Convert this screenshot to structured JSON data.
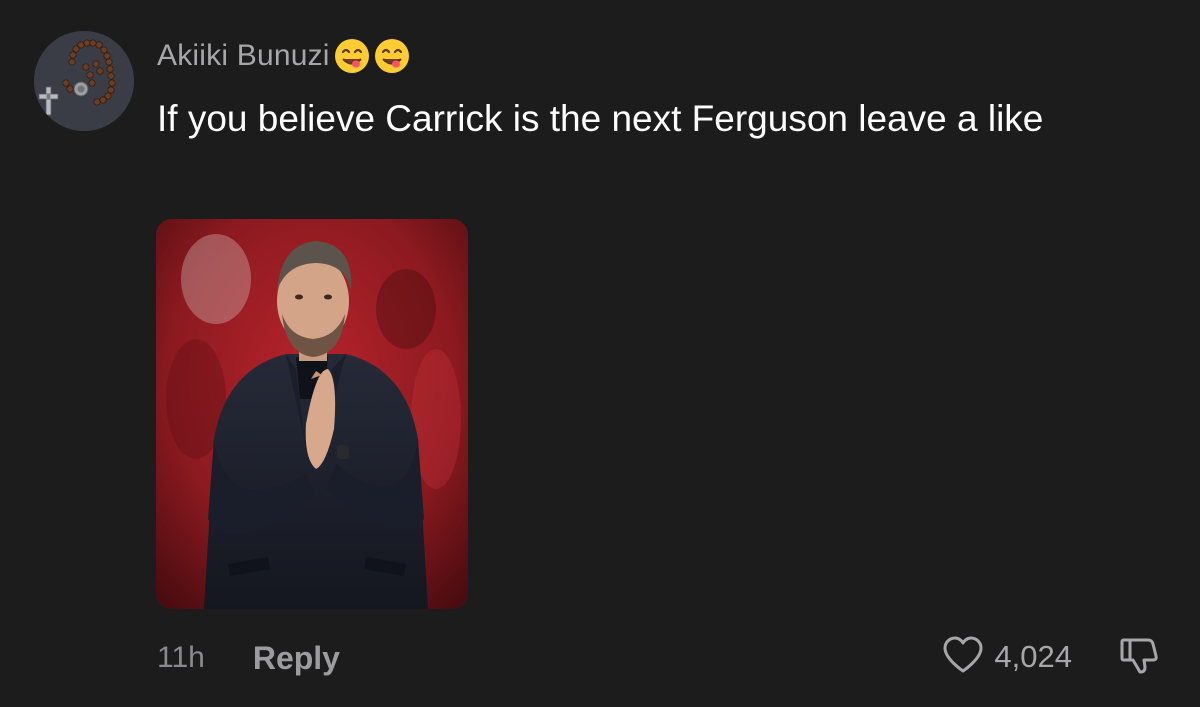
{
  "comment": {
    "author": "Akiiki Bunuzi",
    "author_emojis": [
      "yum-emoji",
      "yum-emoji"
    ],
    "text": "If you believe Carrick is the next Ferguson leave a like",
    "attached_image": "photo-of-man-in-dark-coat-clapping",
    "timestamp": "11h",
    "reply_label": "Reply",
    "like_count": "4,024",
    "icons": {
      "like": "heart-outline-icon",
      "dislike": "thumbs-down-icon"
    }
  },
  "colors": {
    "background": "#1c1c1d",
    "username": "#a7a7a9",
    "text": "#ffffff",
    "muted": "#8a8a8c"
  }
}
